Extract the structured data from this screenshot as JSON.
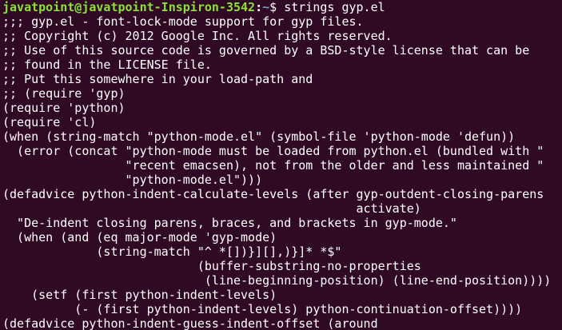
{
  "terminal": {
    "prompt": {
      "user_host": "javatpoint@javatpoint-Inspiron-3542",
      "separator": ":",
      "path": "~",
      "dollar": "$ ",
      "command": "strings gyp.el"
    },
    "lines": [
      ";;; gyp.el - font-lock-mode support for gyp files.",
      ";; Copyright (c) 2012 Google Inc. All rights reserved.",
      ";; Use of this source code is governed by a BSD-style license that can be",
      ";; found in the LICENSE file.",
      ";; Put this somewhere in your load-path and",
      ";; (require 'gyp)",
      "(require 'python)",
      "(require 'cl)",
      "(when (string-match \"python-mode.el\" (symbol-file 'python-mode 'defun))",
      "  (error (concat \"python-mode must be loaded from python.el (bundled with \"",
      "                 \"recent emacsen), not from the older and less maintained \"",
      "                 \"python-mode.el\")))",
      "(defadvice python-indent-calculate-levels (after gyp-outdent-closing-parens",
      "                                                 activate)",
      "  \"De-indent closing parens, braces, and brackets in gyp-mode.\"",
      "  (when (and (eq major-mode 'gyp-mode)",
      "             (string-match \"^ *[])}][],)}]* *$\"",
      "                           (buffer-substring-no-properties",
      "                            (line-beginning-position) (line-end-position))))",
      "    (setf (first python-indent-levels)",
      "          (- (first python-indent-levels) python-continuation-offset))))",
      "(defadvice python-indent-guess-indent-offset (around"
    ]
  }
}
